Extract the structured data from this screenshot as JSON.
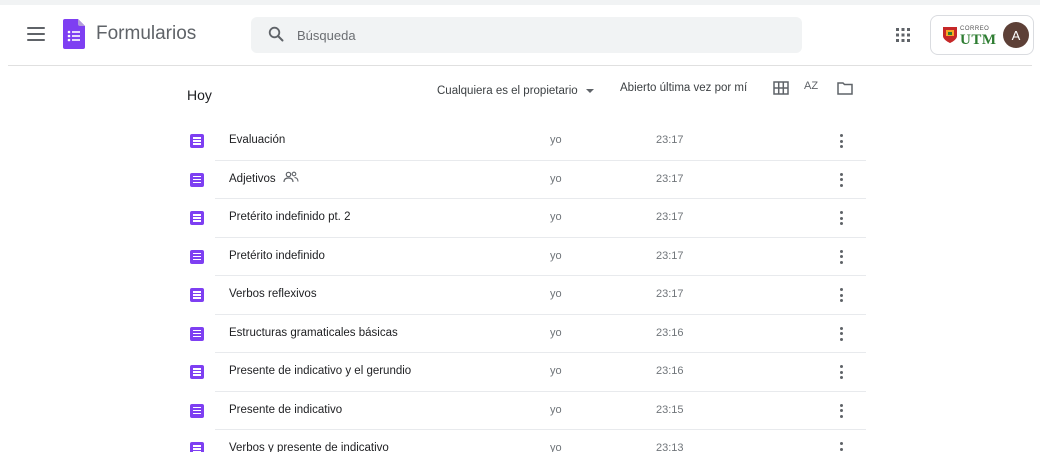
{
  "app": {
    "title": "Formularios",
    "brand_color": "#7e3ff2"
  },
  "search": {
    "placeholder": "Búsqueda",
    "value": ""
  },
  "account": {
    "org_small": "CORREO",
    "org_big": "UTM",
    "avatar_initial": "A",
    "avatar_color": "#5d4037"
  },
  "list": {
    "section_title": "Hoy",
    "owner_filter": "Cualquiera es el propietario",
    "sort_label": "Abierto última vez por mí",
    "az_label": "AZ",
    "rows": [
      {
        "title": "Evaluación",
        "owner": "yo",
        "time": "23:17",
        "shared": false
      },
      {
        "title": "Adjetivos",
        "owner": "yo",
        "time": "23:17",
        "shared": true
      },
      {
        "title": "Pretérito indefinido pt. 2",
        "owner": "yo",
        "time": "23:17",
        "shared": false
      },
      {
        "title": "Pretérito indefinido",
        "owner": "yo",
        "time": "23:17",
        "shared": false
      },
      {
        "title": "Verbos reflexivos",
        "owner": "yo",
        "time": "23:17",
        "shared": false
      },
      {
        "title": "Estructuras gramaticales básicas",
        "owner": "yo",
        "time": "23:16",
        "shared": false
      },
      {
        "title": "Presente de indicativo y el gerundio",
        "owner": "yo",
        "time": "23:16",
        "shared": false
      },
      {
        "title": "Presente de indicativo",
        "owner": "yo",
        "time": "23:15",
        "shared": false
      },
      {
        "title": "Verbos y presente de indicativo",
        "owner": "yo",
        "time": "23:13",
        "shared": false
      }
    ]
  }
}
